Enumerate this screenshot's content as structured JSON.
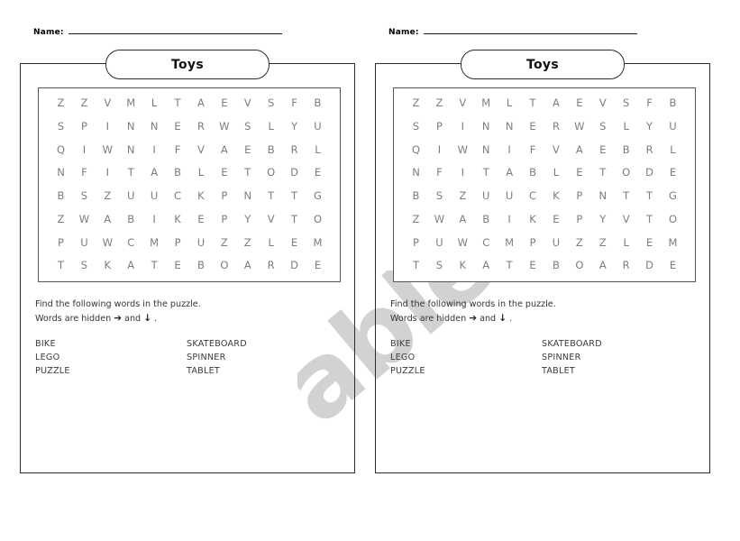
{
  "document": {
    "type": "word-search-worksheet",
    "copies": 2,
    "watermark": "ables.com",
    "watermark_color": "#d2d2d2"
  },
  "worksheet": {
    "name_label": "Name:",
    "title": "Toys",
    "instructions_line1": "Find the following words in the puzzle.",
    "instructions_line2_prefix": "Words are hidden ",
    "instructions_arrow_right": "➔",
    "instructions_line2_middle": " and ",
    "instructions_arrow_down": "↓",
    "instructions_line2_suffix": " .",
    "grid": {
      "rows": 8,
      "cols": 13,
      "letters": [
        [
          "Z",
          "Z",
          "V",
          "M",
          "L",
          "T",
          "A",
          "E",
          "V",
          "S",
          "F",
          "B"
        ],
        [
          "S",
          "P",
          "I",
          "N",
          "N",
          "E",
          "R",
          "W",
          "S",
          "L",
          "Y",
          "U"
        ],
        [
          "Q",
          "I",
          "W",
          "N",
          "I",
          "F",
          "V",
          "A",
          "E",
          "B",
          "R",
          "L"
        ],
        [
          "N",
          "F",
          "I",
          "T",
          "A",
          "B",
          "L",
          "E",
          "T",
          "O",
          "D",
          "E"
        ],
        [
          "B",
          "S",
          "Z",
          "U",
          "U",
          "C",
          "K",
          "P",
          "N",
          "T",
          "T",
          "G"
        ],
        [
          "Z",
          "W",
          "A",
          "B",
          "I",
          "K",
          "E",
          "P",
          "Y",
          "V",
          "T",
          "O"
        ],
        [
          "P",
          "U",
          "W",
          "C",
          "M",
          "P",
          "U",
          "Z",
          "Z",
          "L",
          "E",
          "M"
        ],
        [
          "T",
          "S",
          "K",
          "A",
          "T",
          "E",
          "B",
          "O",
          "A",
          "R",
          "D",
          "E"
        ]
      ]
    },
    "word_rows": [
      {
        "col1": "BIKE",
        "col2": "SKATEBOARD"
      },
      {
        "col1": "LEGO",
        "col2": "SPINNER"
      },
      {
        "col1": "PUZZLE",
        "col2": "TABLET"
      }
    ]
  }
}
